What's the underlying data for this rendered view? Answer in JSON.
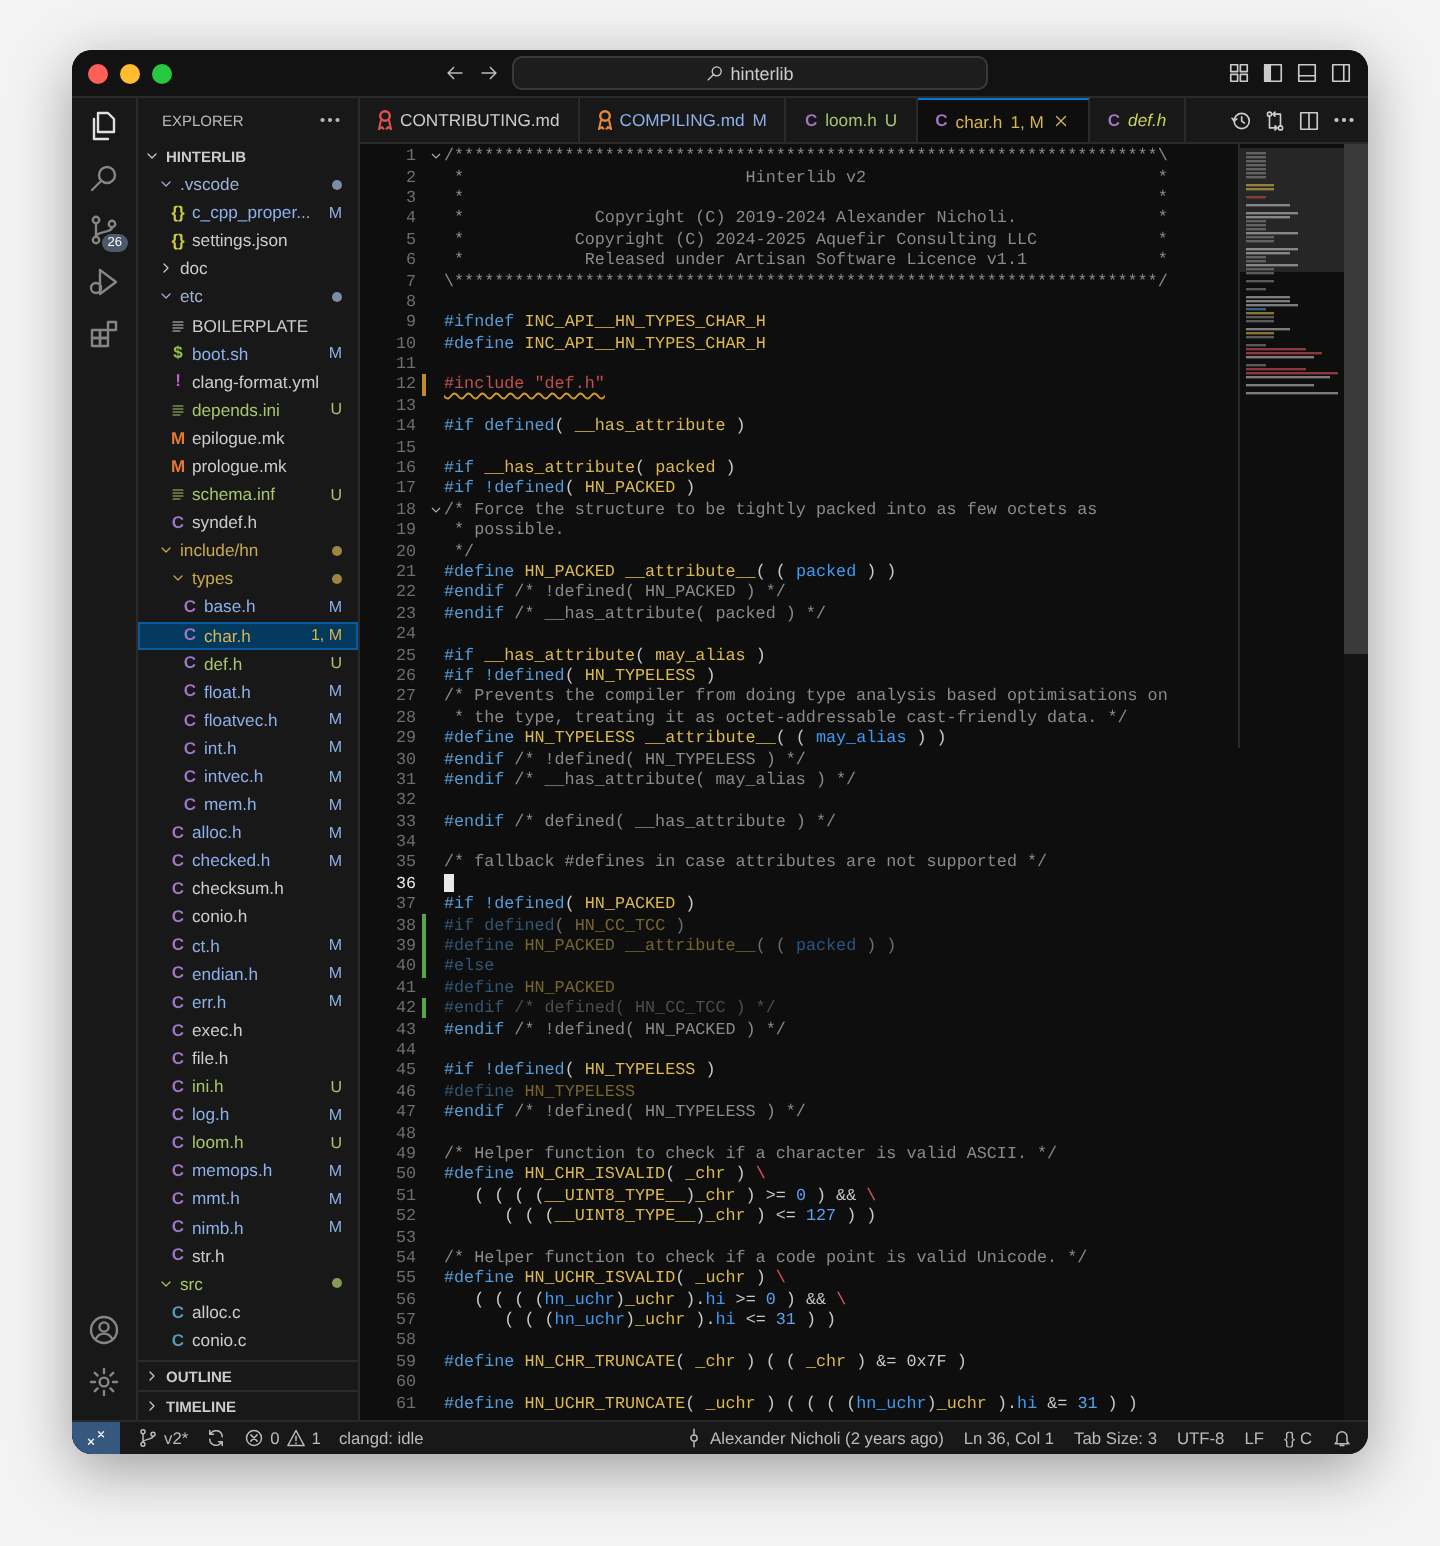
{
  "titlebar": {
    "search": "hinterlib"
  },
  "activity": {
    "items": [
      {
        "kind": "explorer",
        "selected": true
      },
      {
        "kind": "search",
        "selected": false
      },
      {
        "kind": "scm",
        "selected": false,
        "badge": "26"
      },
      {
        "kind": "debug",
        "selected": false
      },
      {
        "kind": "extensions",
        "selected": false
      }
    ]
  },
  "explorer": {
    "title": "EXPLORER",
    "section": "HINTERLIB",
    "tree": [
      {
        "name": ".vscode",
        "expanded": true,
        "dot": true,
        "color": "#9fb3d6",
        "selected": false,
        "children": [
          {
            "name": "c_cpp_proper...",
            "kind": "json",
            "glyph": "{}",
            "color": "#8db0ea",
            "badge": "M",
            "selected": false
          },
          {
            "name": "settings.json",
            "kind": "json",
            "glyph": "{}",
            "color": "#cccccc",
            "selected": false
          }
        ]
      },
      {
        "name": "doc",
        "expanded": false,
        "dot": false,
        "color": "#cccccc",
        "selected": false
      },
      {
        "name": "etc",
        "expanded": true,
        "dot": true,
        "color": "#9fb3d6",
        "selected": false,
        "children": [
          {
            "name": "BOILERPLATE",
            "kind": "text",
            "color": "#cccccc",
            "selected": false
          },
          {
            "name": "boot.sh",
            "kind": "shell",
            "glyph": "$",
            "color": "#8db0ea",
            "badge": "M",
            "selected": false
          },
          {
            "name": "clang-format.yml",
            "kind": "yaml",
            "glyph": "!",
            "color": "#cccccc",
            "selected": false
          },
          {
            "name": "depends.ini",
            "kind": "text",
            "color": "#a8c66a",
            "badge": "U",
            "selected": false
          },
          {
            "name": "epilogue.mk",
            "kind": "make",
            "glyph": "M",
            "color": "#cccccc",
            "selected": false
          },
          {
            "name": "prologue.mk",
            "kind": "make",
            "glyph": "M",
            "color": "#cccccc",
            "selected": false
          },
          {
            "name": "schema.inf",
            "kind": "text",
            "color": "#a8c66a",
            "badge": "U",
            "selected": false
          },
          {
            "name": "syndef.h",
            "kind": "header",
            "glyph": "C",
            "color": "#cccccc",
            "selected": false
          }
        ]
      },
      {
        "name": "include/hn",
        "expanded": true,
        "dot": true,
        "color": "#c9a94f",
        "selected": false,
        "children": [
          {
            "name": "types",
            "expanded": true,
            "dot": true,
            "color": "#c9a94f",
            "selected": false,
            "children": [
              {
                "name": "base.h",
                "kind": "header",
                "glyph": "C",
                "color": "#8db0ea",
                "badge": "M",
                "selected": false
              },
              {
                "name": "char.h",
                "kind": "header",
                "glyph": "C",
                "color": "#d7b44c",
                "badge": "1, M",
                "selected": true
              },
              {
                "name": "def.h",
                "kind": "header",
                "glyph": "C",
                "color": "#a8c66a",
                "badge": "U",
                "selected": false
              },
              {
                "name": "float.h",
                "kind": "header",
                "glyph": "C",
                "color": "#8db0ea",
                "badge": "M",
                "selected": false
              },
              {
                "name": "floatvec.h",
                "kind": "header",
                "glyph": "C",
                "color": "#8db0ea",
                "badge": "M",
                "selected": false
              },
              {
                "name": "int.h",
                "kind": "header",
                "glyph": "C",
                "color": "#8db0ea",
                "badge": "M",
                "selected": false
              },
              {
                "name": "intvec.h",
                "kind": "header",
                "glyph": "C",
                "color": "#8db0ea",
                "badge": "M",
                "selected": false
              },
              {
                "name": "mem.h",
                "kind": "header",
                "glyph": "C",
                "color": "#8db0ea",
                "badge": "M",
                "selected": false
              }
            ]
          },
          {
            "name": "alloc.h",
            "kind": "header",
            "glyph": "C",
            "color": "#8db0ea",
            "badge": "M",
            "selected": false
          },
          {
            "name": "checked.h",
            "kind": "header",
            "glyph": "C",
            "color": "#8db0ea",
            "badge": "M",
            "selected": false
          },
          {
            "name": "checksum.h",
            "kind": "header",
            "glyph": "C",
            "color": "#cccccc",
            "selected": false
          },
          {
            "name": "conio.h",
            "kind": "header",
            "glyph": "C",
            "color": "#cccccc",
            "selected": false
          },
          {
            "name": "ct.h",
            "kind": "header",
            "glyph": "C",
            "color": "#8db0ea",
            "badge": "M",
            "selected": false
          },
          {
            "name": "endian.h",
            "kind": "header",
            "glyph": "C",
            "color": "#8db0ea",
            "badge": "M",
            "selected": false
          },
          {
            "name": "err.h",
            "kind": "header",
            "glyph": "C",
            "color": "#8db0ea",
            "badge": "M",
            "selected": false
          },
          {
            "name": "exec.h",
            "kind": "header",
            "glyph": "C",
            "color": "#cccccc",
            "selected": false
          },
          {
            "name": "file.h",
            "kind": "header",
            "glyph": "C",
            "color": "#cccccc",
            "selected": false
          },
          {
            "name": "ini.h",
            "kind": "header",
            "glyph": "C",
            "color": "#a8c66a",
            "badge": "U",
            "selected": false
          },
          {
            "name": "log.h",
            "kind": "header",
            "glyph": "C",
            "color": "#8db0ea",
            "badge": "M",
            "selected": false
          },
          {
            "name": "loom.h",
            "kind": "header",
            "glyph": "C",
            "color": "#a8c66a",
            "badge": "U",
            "selected": false
          },
          {
            "name": "memops.h",
            "kind": "header",
            "glyph": "C",
            "color": "#8db0ea",
            "badge": "M",
            "selected": false
          },
          {
            "name": "mmt.h",
            "kind": "header",
            "glyph": "C",
            "color": "#8db0ea",
            "badge": "M",
            "selected": false
          },
          {
            "name": "nimb.h",
            "kind": "header",
            "glyph": "C",
            "color": "#8db0ea",
            "badge": "M",
            "selected": false
          },
          {
            "name": "str.h",
            "kind": "header",
            "glyph": "C",
            "color": "#cccccc",
            "selected": false
          }
        ]
      },
      {
        "name": "src",
        "expanded": true,
        "dot": true,
        "color": "#a8c66a",
        "selected": false,
        "children": [
          {
            "name": "alloc.c",
            "kind": "source",
            "glyph": "C",
            "color": "#cccccc",
            "selected": false
          },
          {
            "name": "conio.c",
            "kind": "source",
            "glyph": "C",
            "color": "#cccccc",
            "selected": false
          }
        ]
      }
    ],
    "panels": [
      {
        "label": "OUTLINE",
        "expanded": false
      },
      {
        "label": "TIMELINE",
        "expanded": false
      }
    ]
  },
  "tabs": [
    {
      "label": "CONTRIBUTING.md",
      "kind": "markdown",
      "icon": {
        "color": "#e05252"
      },
      "color": "#cccccc",
      "selected": false,
      "preview": false
    },
    {
      "label": "COMPILING.md",
      "kind": "markdown",
      "icon": {
        "color": "#e8893a"
      },
      "color": "#8db0ea",
      "badge": "M",
      "selected": false,
      "preview": false
    },
    {
      "label": "loom.h",
      "kind": "header",
      "glyph": "C",
      "color": "#a8c66a",
      "badge": "U",
      "selected": false,
      "preview": false
    },
    {
      "label": "char.h",
      "kind": "header",
      "glyph": "C",
      "color": "#d7b44c",
      "badge": "1, M",
      "selected": true,
      "preview": false
    },
    {
      "label": "def.h",
      "kind": "header",
      "glyph": "C",
      "color": "#c7d35a",
      "selected": false,
      "preview": true
    }
  ],
  "lines": [
    {
      "n": "1",
      "fold": true,
      "tokens": [
        {
          "kind": "com",
          "text": "/**********************************************************************\\"
        }
      ]
    },
    {
      "n": "2",
      "tokens": [
        {
          "kind": "com",
          "text": " *                            Hinterlib v2                             *"
        }
      ]
    },
    {
      "n": "3",
      "tokens": [
        {
          "kind": "com",
          "text": " *                                                                     *"
        }
      ]
    },
    {
      "n": "4",
      "tokens": [
        {
          "kind": "com",
          "text": " *             Copyright (C) 2019-2024 Alexander Nicholi.              *"
        }
      ]
    },
    {
      "n": "5",
      "tokens": [
        {
          "kind": "com",
          "text": " *           Copyright (C) 2024-2025 Aquefir Consulting LLC            *"
        }
      ]
    },
    {
      "n": "6",
      "tokens": [
        {
          "kind": "com",
          "text": " *            Released under Artisan Software Licence v1.1             *"
        }
      ]
    },
    {
      "n": "7",
      "tokens": [
        {
          "kind": "com",
          "text": "\\**********************************************************************/"
        }
      ]
    },
    {
      "n": "8"
    },
    {
      "n": "9",
      "tokens": [
        {
          "kind": "dir",
          "text": "#ifndef "
        },
        {
          "kind": "mac",
          "text": "INC_API__HN_TYPES_CHAR_H"
        }
      ]
    },
    {
      "n": "10",
      "tokens": [
        {
          "kind": "dir",
          "text": "#define "
        },
        {
          "kind": "mac",
          "text": "INC_API__HN_TYPES_CHAR_H"
        }
      ]
    },
    {
      "n": "11"
    },
    {
      "n": "12",
      "change": {
        "kind": "modified"
      },
      "tokens": [
        {
          "kind": "err",
          "text": "#include \"def.h\""
        }
      ]
    },
    {
      "n": "13"
    },
    {
      "n": "14",
      "tokens": [
        {
          "kind": "dir",
          "text": "#if defined"
        },
        {
          "kind": "pun",
          "text": "( "
        },
        {
          "kind": "mac",
          "text": "__has_attribute"
        },
        {
          "kind": "pun",
          "text": " )"
        }
      ]
    },
    {
      "n": "15"
    },
    {
      "n": "16",
      "tokens": [
        {
          "kind": "dir",
          "text": "#if "
        },
        {
          "kind": "mac",
          "text": "__has_attribute"
        },
        {
          "kind": "pun",
          "text": "( "
        },
        {
          "kind": "mac",
          "text": "packed"
        },
        {
          "kind": "pun",
          "text": " )"
        }
      ]
    },
    {
      "n": "17",
      "tokens": [
        {
          "kind": "dir",
          "text": "#if !defined"
        },
        {
          "kind": "pun",
          "text": "( "
        },
        {
          "kind": "mac",
          "text": "HN_PACKED"
        },
        {
          "kind": "pun",
          "text": " )"
        }
      ]
    },
    {
      "n": "18",
      "fold": true,
      "tokens": [
        {
          "kind": "com",
          "text": "/* Force the structure to be tightly packed into as few octets as"
        }
      ]
    },
    {
      "n": "19",
      "tokens": [
        {
          "kind": "com",
          "text": " * possible."
        }
      ]
    },
    {
      "n": "20",
      "tokens": [
        {
          "kind": "com",
          "text": " */"
        }
      ]
    },
    {
      "n": "21",
      "tokens": [
        {
          "kind": "dir",
          "text": "#define "
        },
        {
          "kind": "mac",
          "text": "HN_PACKED __attribute__"
        },
        {
          "kind": "pun",
          "text": "( ( "
        },
        {
          "kind": "kw",
          "text": "packed"
        },
        {
          "kind": "pun",
          "text": " ) )"
        }
      ]
    },
    {
      "n": "22",
      "tokens": [
        {
          "kind": "dir",
          "text": "#endif"
        },
        {
          "kind": "com",
          "text": " /* !defined( HN_PACKED ) */"
        }
      ]
    },
    {
      "n": "23",
      "tokens": [
        {
          "kind": "dir",
          "text": "#endif"
        },
        {
          "kind": "com",
          "text": " /* __has_attribute( packed ) */"
        }
      ]
    },
    {
      "n": "24"
    },
    {
      "n": "25",
      "tokens": [
        {
          "kind": "dir",
          "text": "#if "
        },
        {
          "kind": "mac",
          "text": "__has_attribute"
        },
        {
          "kind": "pun",
          "text": "( "
        },
        {
          "kind": "mac",
          "text": "may_alias"
        },
        {
          "kind": "pun",
          "text": " )"
        }
      ]
    },
    {
      "n": "26",
      "tokens": [
        {
          "kind": "dir",
          "text": "#if !defined"
        },
        {
          "kind": "pun",
          "text": "( "
        },
        {
          "kind": "mac",
          "text": "HN_TYPELESS"
        },
        {
          "kind": "pun",
          "text": " )"
        }
      ]
    },
    {
      "n": "27",
      "tokens": [
        {
          "kind": "com",
          "text": "/* Prevents the compiler from doing type analysis based optimisations on"
        }
      ]
    },
    {
      "n": "28",
      "tokens": [
        {
          "kind": "com",
          "text": " * the type, treating it as octet-addressable cast-friendly data. */"
        }
      ]
    },
    {
      "n": "29",
      "tokens": [
        {
          "kind": "dir",
          "text": "#define "
        },
        {
          "kind": "mac",
          "text": "HN_TYPELESS __attribute__"
        },
        {
          "kind": "pun",
          "text": "( ( "
        },
        {
          "kind": "kw",
          "text": "may_alias"
        },
        {
          "kind": "pun",
          "text": " ) )"
        }
      ]
    },
    {
      "n": "30",
      "tokens": [
        {
          "kind": "dir",
          "text": "#endif"
        },
        {
          "kind": "com",
          "text": " /* !defined( HN_TYPELESS ) */"
        }
      ]
    },
    {
      "n": "31",
      "tokens": [
        {
          "kind": "dir",
          "text": "#endif"
        },
        {
          "kind": "com",
          "text": " /* __has_attribute( may_alias ) */"
        }
      ]
    },
    {
      "n": "32"
    },
    {
      "n": "33",
      "tokens": [
        {
          "kind": "dir",
          "text": "#endif"
        },
        {
          "kind": "com",
          "text": " /* defined( __has_attribute ) */"
        }
      ]
    },
    {
      "n": "34"
    },
    {
      "n": "35",
      "tokens": [
        {
          "kind": "com",
          "text": "/* fallback #defines in case attributes are not supported */"
        }
      ]
    },
    {
      "n": "36",
      "current": true
    },
    {
      "n": "37",
      "tokens": [
        {
          "kind": "dir",
          "text": "#if !defined"
        },
        {
          "kind": "pun",
          "text": "( "
        },
        {
          "kind": "mac",
          "text": "HN_PACKED"
        },
        {
          "kind": "pun",
          "text": " )"
        }
      ]
    },
    {
      "n": "38",
      "change": {
        "kind": "added"
      },
      "dim": true,
      "tokens": [
        {
          "kind": "dir",
          "text": "#if defined"
        },
        {
          "kind": "pun",
          "text": "( "
        },
        {
          "kind": "mac",
          "text": "HN_CC_TCC"
        },
        {
          "kind": "pun",
          "text": " )"
        }
      ]
    },
    {
      "n": "39",
      "change": {
        "kind": "added"
      },
      "dim": true,
      "tokens": [
        {
          "kind": "dir",
          "text": "#define "
        },
        {
          "kind": "mac",
          "text": "HN_PACKED __attribute__"
        },
        {
          "kind": "pun",
          "text": "( ( "
        },
        {
          "kind": "kw",
          "text": "packed"
        },
        {
          "kind": "pun",
          "text": " ) )"
        }
      ]
    },
    {
      "n": "40",
      "change": {
        "kind": "added"
      },
      "dim": true,
      "tokens": [
        {
          "kind": "dir",
          "text": "#else"
        }
      ]
    },
    {
      "n": "41",
      "dim": true,
      "tokens": [
        {
          "kind": "dir",
          "text": "#define "
        },
        {
          "kind": "mac",
          "text": "HN_PACKED"
        }
      ]
    },
    {
      "n": "42",
      "change": {
        "kind": "added"
      },
      "dim": true,
      "tokens": [
        {
          "kind": "dir",
          "text": "#endif"
        },
        {
          "kind": "com",
          "text": " /* defined( HN_CC_TCC ) */"
        }
      ]
    },
    {
      "n": "43",
      "tokens": [
        {
          "kind": "dir",
          "text": "#endif"
        },
        {
          "kind": "com",
          "text": " /* !defined( HN_PACKED ) */"
        }
      ]
    },
    {
      "n": "44"
    },
    {
      "n": "45",
      "tokens": [
        {
          "kind": "dir",
          "text": "#if !defined"
        },
        {
          "kind": "pun",
          "text": "( "
        },
        {
          "kind": "mac",
          "text": "HN_TYPELESS"
        },
        {
          "kind": "pun",
          "text": " )"
        }
      ]
    },
    {
      "n": "46",
      "dim": true,
      "tokens": [
        {
          "kind": "dir",
          "text": "#define "
        },
        {
          "kind": "mac",
          "text": "HN_TYPELESS"
        }
      ]
    },
    {
      "n": "47",
      "tokens": [
        {
          "kind": "dir",
          "text": "#endif"
        },
        {
          "kind": "com",
          "text": " /* !defined( HN_TYPELESS ) */"
        }
      ]
    },
    {
      "n": "48"
    },
    {
      "n": "49",
      "tokens": [
        {
          "kind": "com",
          "text": "/* Helper function to check if a character is valid ASCII. */"
        }
      ]
    },
    {
      "n": "50",
      "tokens": [
        {
          "kind": "dir",
          "text": "#define "
        },
        {
          "kind": "mac",
          "text": "HN_CHR_ISVALID"
        },
        {
          "kind": "pun",
          "text": "( "
        },
        {
          "kind": "mac",
          "text": "_chr"
        },
        {
          "kind": "pun",
          "text": " ) "
        },
        {
          "kind": "esc",
          "text": "\\"
        }
      ]
    },
    {
      "n": "51",
      "tokens": [
        {
          "kind": "pun",
          "text": "   ( ( ( ("
        },
        {
          "kind": "mac",
          "text": "__UINT8_TYPE__"
        },
        {
          "kind": "pun",
          "text": ")"
        },
        {
          "kind": "mac",
          "text": "_chr"
        },
        {
          "kind": "pun",
          "text": " ) >= "
        },
        {
          "kind": "num",
          "text": "0"
        },
        {
          "kind": "pun",
          "text": " ) && "
        },
        {
          "kind": "esc",
          "text": "\\"
        }
      ]
    },
    {
      "n": "52",
      "tokens": [
        {
          "kind": "pun",
          "text": "      ( ( ("
        },
        {
          "kind": "mac",
          "text": "__UINT8_TYPE__"
        },
        {
          "kind": "pun",
          "text": ")"
        },
        {
          "kind": "mac",
          "text": "_chr"
        },
        {
          "kind": "pun",
          "text": " ) <= "
        },
        {
          "kind": "num",
          "text": "127"
        },
        {
          "kind": "pun",
          "text": " ) )"
        }
      ]
    },
    {
      "n": "53"
    },
    {
      "n": "54",
      "tokens": [
        {
          "kind": "com",
          "text": "/* Helper function to check if a code point is valid Unicode. */"
        }
      ]
    },
    {
      "n": "55",
      "tokens": [
        {
          "kind": "dir",
          "text": "#define "
        },
        {
          "kind": "mac",
          "text": "HN_UCHR_ISVALID"
        },
        {
          "kind": "pun",
          "text": "( "
        },
        {
          "kind": "mac",
          "text": "_uchr"
        },
        {
          "kind": "pun",
          "text": " ) "
        },
        {
          "kind": "esc",
          "text": "\\"
        }
      ]
    },
    {
      "n": "56",
      "tokens": [
        {
          "kind": "pun",
          "text": "   ( ( ( ("
        },
        {
          "kind": "kw",
          "text": "hn_uchr"
        },
        {
          "kind": "pun",
          "text": ")"
        },
        {
          "kind": "mac",
          "text": "_uchr"
        },
        {
          "kind": "pun",
          "text": " )."
        },
        {
          "kind": "kw",
          "text": "hi"
        },
        {
          "kind": "pun",
          "text": " >= "
        },
        {
          "kind": "num",
          "text": "0"
        },
        {
          "kind": "pun",
          "text": " ) && "
        },
        {
          "kind": "esc",
          "text": "\\"
        }
      ]
    },
    {
      "n": "57",
      "tokens": [
        {
          "kind": "pun",
          "text": "      ( ( ("
        },
        {
          "kind": "kw",
          "text": "hn_uchr"
        },
        {
          "kind": "pun",
          "text": ")"
        },
        {
          "kind": "mac",
          "text": "_uchr"
        },
        {
          "kind": "pun",
          "text": " )."
        },
        {
          "kind": "kw",
          "text": "hi"
        },
        {
          "kind": "pun",
          "text": " <= "
        },
        {
          "kind": "num",
          "text": "31"
        },
        {
          "kind": "pun",
          "text": " ) )"
        }
      ]
    },
    {
      "n": "58"
    },
    {
      "n": "59",
      "tokens": [
        {
          "kind": "dir",
          "text": "#define "
        },
        {
          "kind": "mac",
          "text": "HN_CHR_TRUNCATE"
        },
        {
          "kind": "pun",
          "text": "( "
        },
        {
          "kind": "mac",
          "text": "_chr"
        },
        {
          "kind": "pun",
          "text": " ) ( ( "
        },
        {
          "kind": "mac",
          "text": "_chr"
        },
        {
          "kind": "pun",
          "text": " ) &= 0x7F )"
        }
      ]
    },
    {
      "n": "60"
    },
    {
      "n": "61",
      "tokens": [
        {
          "kind": "dir",
          "text": "#define "
        },
        {
          "kind": "mac",
          "text": "HN_UCHR_TRUNCATE"
        },
        {
          "kind": "pun",
          "text": "( "
        },
        {
          "kind": "mac",
          "text": "_uchr"
        },
        {
          "kind": "pun",
          "text": " ) ( ( ( ("
        },
        {
          "kind": "kw",
          "text": "hn_uchr"
        },
        {
          "kind": "pun",
          "text": ")"
        },
        {
          "kind": "mac",
          "text": "_uchr"
        },
        {
          "kind": "pun",
          "text": " )."
        },
        {
          "kind": "kw",
          "text": "hi"
        },
        {
          "kind": "pun",
          "text": " &= "
        },
        {
          "kind": "num",
          "text": "31"
        },
        {
          "kind": "pun",
          "text": " ) )"
        }
      ]
    }
  ],
  "status_bar": {
    "branch": "v2*",
    "errors": "0",
    "warnings": "1",
    "language_server": "clangd: idle",
    "blame": "Alexander Nicholi (2 years ago)",
    "position": "Ln 36, Col 1",
    "tab_size": "Tab Size: 3",
    "encoding": "UTF-8",
    "eol": "LF",
    "language_glyph": "{}",
    "language": "C"
  }
}
